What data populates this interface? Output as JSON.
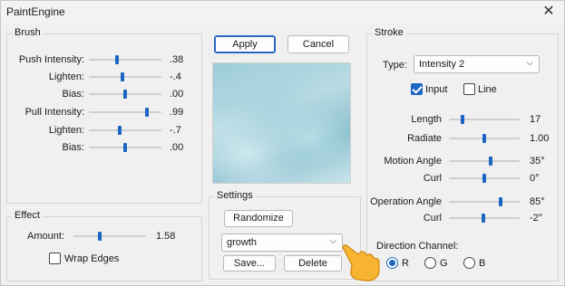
{
  "window": {
    "title": "PaintEngine",
    "close_glyph": "✕"
  },
  "brush": {
    "label": "Brush",
    "sliders": [
      {
        "label": "Push Intensity:",
        "value": ".38",
        "level": 0.38
      },
      {
        "label": "Lighten:",
        "value": "-.4",
        "level": 0.46
      },
      {
        "label": "Bias:",
        "value": ".00",
        "level": 0.5
      },
      {
        "label": "Pull Intensity:",
        "value": ".99",
        "level": 0.82
      },
      {
        "label": "Lighten:",
        "value": "-.7",
        "level": 0.42
      },
      {
        "label": "Bias:",
        "value": ".00",
        "level": 0.5
      }
    ]
  },
  "effect": {
    "label": "Effect",
    "amount_label": "Amount:",
    "amount_value": "1.58",
    "amount_level": 0.36,
    "wrap_label": "Wrap Edges",
    "wrap_checked": false
  },
  "actions": {
    "apply_label": "Apply",
    "cancel_label": "Cancel"
  },
  "settings": {
    "label": "Settings",
    "randomize_label": "Randomize",
    "preset_value": "growth",
    "save_label": "Save...",
    "delete_label": "Delete"
  },
  "stroke": {
    "label": "Stroke",
    "type_label": "Type:",
    "type_value": "Intensity 2",
    "input_label": "Input",
    "input_checked": true,
    "line_label": "Line",
    "line_checked": false,
    "sliders": [
      {
        "label": "Length",
        "value": "17",
        "level": 0.17
      },
      {
        "label": "Radiate",
        "value": "1.00",
        "level": 0.5
      },
      {
        "label": "Motion Angle",
        "value": "35°",
        "level": 0.6
      },
      {
        "label": "Curl",
        "value": "0°",
        "level": 0.5
      },
      {
        "label": "Operation Angle",
        "value": "85°",
        "level": 0.74
      },
      {
        "label": "Curl",
        "value": "-2°",
        "level": 0.48
      }
    ],
    "direction_label": "Direction Channel:",
    "channels": [
      {
        "label": "R",
        "checked": true
      },
      {
        "label": "G",
        "checked": false
      },
      {
        "label": "B",
        "checked": false
      }
    ]
  },
  "colors": {
    "accent": "#1a66c2"
  }
}
